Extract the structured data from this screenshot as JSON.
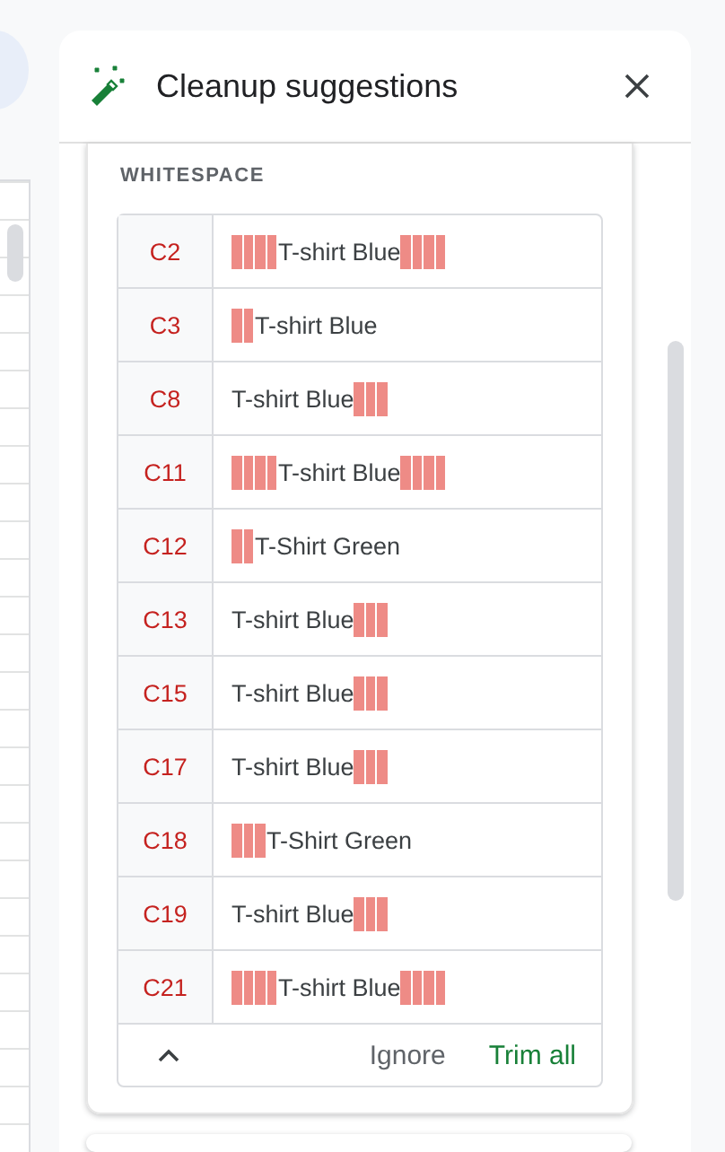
{
  "panel": {
    "title": "Cleanup suggestions"
  },
  "section": {
    "heading": "WHITESPACE",
    "rows": [
      {
        "cell": "C2",
        "value": "    T-shirt Blue    "
      },
      {
        "cell": "C3",
        "value": "  T-shirt Blue"
      },
      {
        "cell": "C8",
        "value": "T-shirt Blue   "
      },
      {
        "cell": "C11",
        "value": "    T-shirt Blue    "
      },
      {
        "cell": "C12",
        "value": "  T-Shirt Green"
      },
      {
        "cell": "C13",
        "value": "T-shirt Blue   "
      },
      {
        "cell": "C15",
        "value": "T-shirt Blue   "
      },
      {
        "cell": "C17",
        "value": "T-shirt Blue   "
      },
      {
        "cell": "C18",
        "value": "   T-Shirt Green"
      },
      {
        "cell": "C19",
        "value": "T-shirt Blue   "
      },
      {
        "cell": "C21",
        "value": "    T-shirt Blue    "
      }
    ],
    "actions": [
      "Ignore",
      "Trim all"
    ]
  }
}
